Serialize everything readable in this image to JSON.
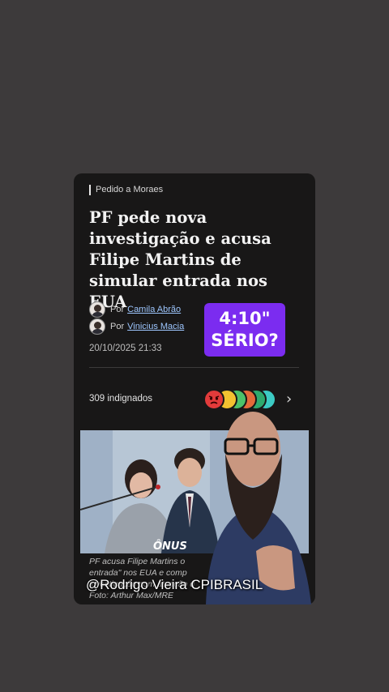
{
  "article": {
    "kicker": "Pedido a Moraes",
    "headline": "PF pede nova investigação e acusa Filipe Martins de simular entrada nos EUA",
    "authors": [
      {
        "prefix": "Por",
        "name": "Camila Abrão"
      },
      {
        "prefix": "Por",
        "name": "Vinicius Macia"
      }
    ],
    "date": "20/10/2025 21:33",
    "reactions_count": "309 indignados",
    "caption_lines": [
      "PF acusa Filipe Martins o",
      "entrada\" nos EUA e comp",
      "investigação com atuação d",
      "Foto: Arthur Max/MRE"
    ],
    "source_logo": "ÔNUS"
  },
  "overlay": {
    "badge_line1": "4:10\"",
    "badge_line2": "SÉRIO?",
    "handle": "@Rodrigo Vieira CPIBRASIL"
  },
  "colors": {
    "background": "#3d3a3b",
    "card": "#181717",
    "badge": "#7b2cf0",
    "link": "#9ec7ff"
  },
  "icons": [
    "angry-emoji-icon",
    "reaction-emoji-icon",
    "chevron-right-icon"
  ]
}
